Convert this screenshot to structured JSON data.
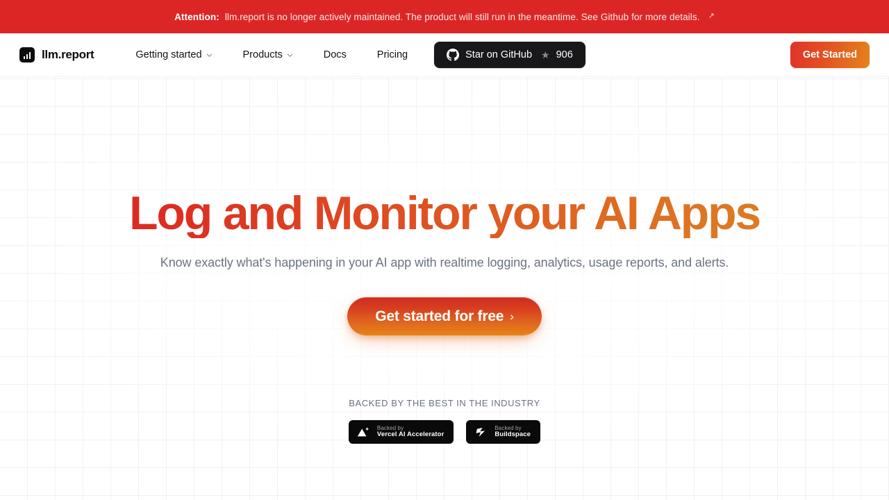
{
  "banner": {
    "strong": "Attention:",
    "text": "llm.report is no longer actively maintained. The product will still run in the meantime. See Github for more details.",
    "arrow_icon": "arrow-up-right-icon",
    "bg_color": "#DC2626"
  },
  "header": {
    "brand": {
      "name": "llm.report",
      "icon": "bar-chart-logo-icon"
    },
    "nav": [
      {
        "label": "Getting started",
        "has_caret": true
      },
      {
        "label": "Products",
        "has_caret": true
      },
      {
        "label": "Docs",
        "has_caret": false
      },
      {
        "label": "Pricing",
        "has_caret": false
      }
    ],
    "github": {
      "label": "Star on GitHub",
      "count": "906",
      "icon": "github-icon",
      "star_icon": "star-icon"
    },
    "cta": {
      "label": "Get Started"
    }
  },
  "hero": {
    "headline": "Log and Monitor your AI Apps",
    "subhead": "Know exactly what's happening in your AI app with realtime logging, analytics, usage reports, and alerts.",
    "cta": {
      "label": "Get started for free",
      "arrow": "›"
    },
    "gradient_start": "#DA2420",
    "gradient_end": "#DC8222"
  },
  "backers": {
    "label": "BACKED BY THE BEST IN THE INDUSTRY",
    "badges": [
      {
        "top": "Backed by",
        "name": "Vercel AI Accelerator",
        "icon": "vercel-triangle-icon"
      },
      {
        "top": "Backed by",
        "name": "Buildspace",
        "icon": "buildspace-icon"
      }
    ]
  }
}
